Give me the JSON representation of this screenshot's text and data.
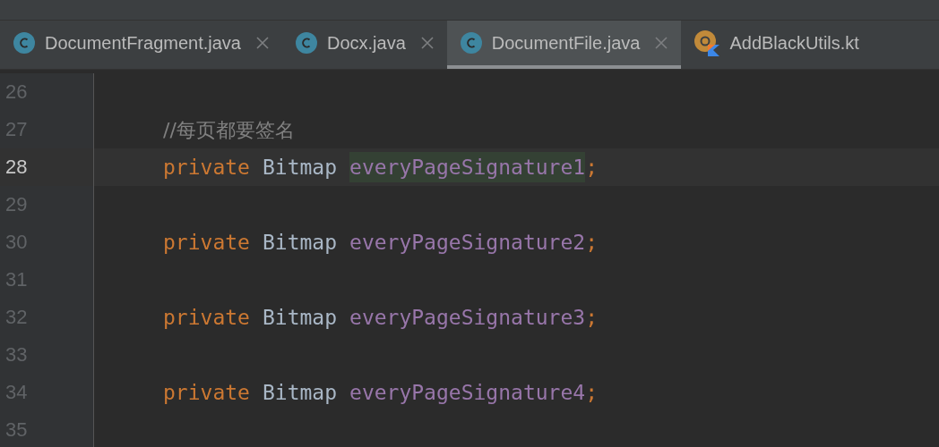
{
  "tabs": [
    {
      "label": "DocumentFragment.java",
      "kind": "class",
      "selected": false
    },
    {
      "label": "Docx.java",
      "kind": "class",
      "selected": false
    },
    {
      "label": "DocumentFile.java",
      "kind": "class",
      "selected": true
    },
    {
      "label": "AddBlackUtils.kt",
      "kind": "kotlin",
      "selected": false
    }
  ],
  "lines": [
    {
      "number": "26",
      "current": false
    },
    {
      "number": "27",
      "current": false,
      "tokens": [
        {
          "kind": "comment",
          "text": "//每页都要签名",
          "highlighted": false
        }
      ]
    },
    {
      "number": "28",
      "current": true,
      "tokens": [
        {
          "kind": "keyword",
          "text": "private",
          "highlighted": false
        },
        {
          "kind": "type",
          "text": "Bitmap",
          "highlighted": false
        },
        {
          "kind": "field",
          "text": "everyPageSignature1",
          "highlighted": true
        },
        {
          "kind": "punct",
          "text": ";",
          "highlighted": false
        }
      ]
    },
    {
      "number": "29",
      "current": false
    },
    {
      "number": "30",
      "current": false,
      "tokens": [
        {
          "kind": "keyword",
          "text": "private",
          "highlighted": false
        },
        {
          "kind": "type",
          "text": "Bitmap",
          "highlighted": false
        },
        {
          "kind": "field",
          "text": "everyPageSignature2",
          "highlighted": false
        },
        {
          "kind": "punct",
          "text": ";",
          "highlighted": false
        }
      ]
    },
    {
      "number": "31",
      "current": false
    },
    {
      "number": "32",
      "current": false,
      "tokens": [
        {
          "kind": "keyword",
          "text": "private",
          "highlighted": false
        },
        {
          "kind": "type",
          "text": "Bitmap",
          "highlighted": false
        },
        {
          "kind": "field",
          "text": "everyPageSignature3",
          "highlighted": false
        },
        {
          "kind": "punct",
          "text": ";",
          "highlighted": false
        }
      ]
    },
    {
      "number": "33",
      "current": false
    },
    {
      "number": "34",
      "current": false,
      "tokens": [
        {
          "kind": "keyword",
          "text": "private",
          "highlighted": false
        },
        {
          "kind": "type",
          "text": "Bitmap",
          "highlighted": false
        },
        {
          "kind": "field",
          "text": "everyPageSignature4",
          "highlighted": false
        },
        {
          "kind": "punct",
          "text": ";",
          "highlighted": false
        }
      ]
    },
    {
      "number": "35",
      "current": false
    }
  ]
}
